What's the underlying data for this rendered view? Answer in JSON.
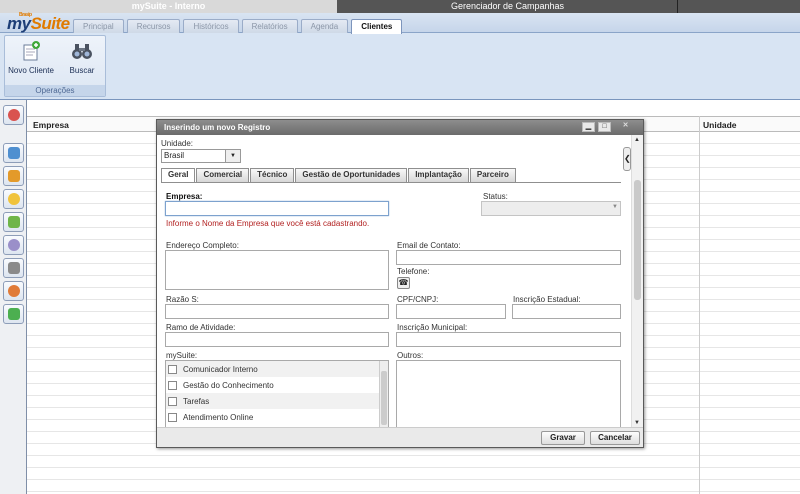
{
  "top_tabs": {
    "suite": "mySuite - Interno",
    "campanhas": "Gerenciador de Campanhas"
  },
  "logo": {
    "brand": "Brasip",
    "name_my": "my",
    "name_suite": "Suite"
  },
  "menu_tabs": [
    "Principal",
    "Recursos",
    "Históricos",
    "Relatórios",
    "Agenda",
    "Clientes"
  ],
  "active_menu_tab": "Clientes",
  "operations": {
    "novo_cliente": "Novo Cliente",
    "buscar": "Buscar",
    "group_label": "Operações"
  },
  "left_icons": [
    "home-icon",
    "document-edit-icon",
    "contacts-icon",
    "clock-icon",
    "stack-icon",
    "network-icon",
    "phone-icon",
    "user-icon",
    "refresh-icon"
  ],
  "grid": {
    "columns": [
      "Empresa",
      "Unidade"
    ]
  },
  "dialog": {
    "title": "Inserindo um novo Registro",
    "unidade_label": "Unidade:",
    "unidade_value": "Brasil",
    "tabs": [
      "Geral",
      "Comercial",
      "Técnico",
      "Gestão de Oportunidades",
      "Implantação",
      "Parceiro"
    ],
    "active_tab": "Geral",
    "fields": {
      "empresa": "Empresa:",
      "empresa_hint": "Informe o Nome da Empresa que você está cadastrando.",
      "status": "Status:",
      "endereco": "Endereço Completo:",
      "email": "Email de Contato:",
      "telefone": "Telefone:",
      "razao": "Razão S:",
      "cpf": "CPF/CNPJ:",
      "inscricao_estadual": "Inscrição Estadual:",
      "ramo": "Ramo de Atividade:",
      "inscricao_municipal": "Inscrição Municipal:",
      "mysuite": "mySuite:",
      "outros": "Outros:"
    },
    "mysuite_options": [
      "Comunicador Interno",
      "Gestão do Conhecimento",
      "Tarefas",
      "Atendimento Online"
    ],
    "buttons": {
      "gravar": "Gravar",
      "cancelar": "Cancelar"
    }
  },
  "colors": {
    "ribbon_bg": "#d8e4f3",
    "hint_red": "#b22222",
    "title_bar": "#6b6b6b"
  }
}
